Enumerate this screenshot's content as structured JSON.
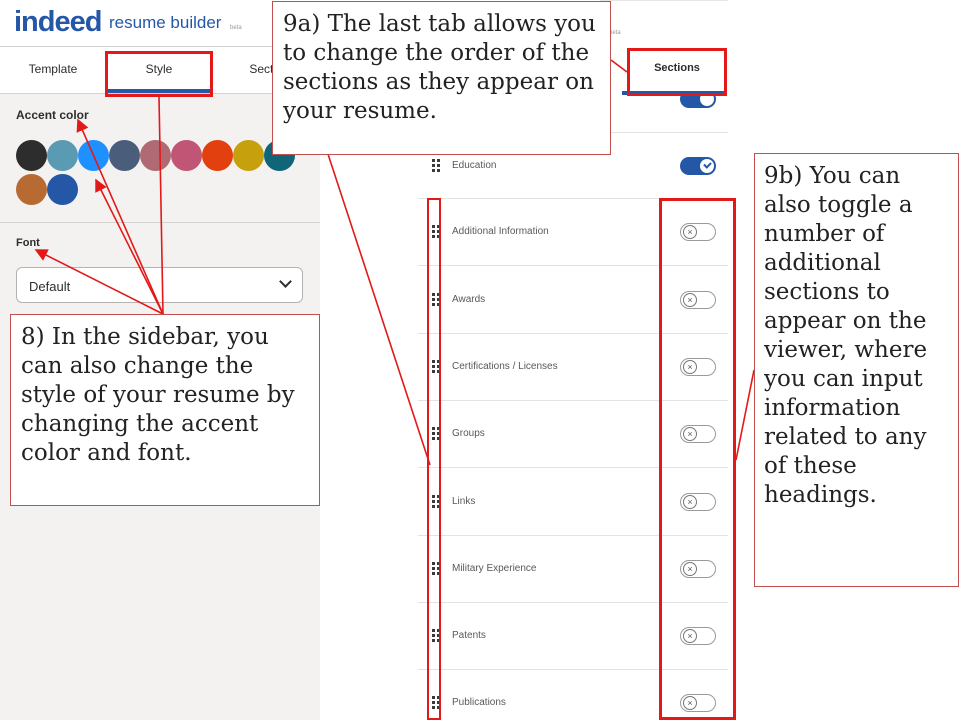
{
  "header": {
    "logo_word": "indeed",
    "logo_sub": "resume builder",
    "beta": "beta"
  },
  "sidebar": {
    "tabs": [
      {
        "label": "Template"
      },
      {
        "label": "Style"
      },
      {
        "label": "Sectio"
      }
    ],
    "accent_title": "Accent color",
    "swatches": [
      "#2d2d2d",
      "#5b9ab3",
      "#1e90ff",
      "#4a5e7c",
      "#b06a73",
      "#c05576",
      "#e2400e",
      "#c7a00e",
      "#0f6678",
      "#b86a33",
      "#2557a7"
    ],
    "font_title": "Font",
    "font_value": "Default"
  },
  "sections_panel": {
    "tab_label": "Sections",
    "beta": "beta",
    "rows": [
      {
        "label": "Education",
        "enabled": true
      },
      {
        "label": "Additional Information",
        "enabled": false
      },
      {
        "label": "Awards",
        "enabled": false
      },
      {
        "label": "Certifications / Licenses",
        "enabled": false
      },
      {
        "label": "Groups",
        "enabled": false
      },
      {
        "label": "Links",
        "enabled": false
      },
      {
        "label": "Military Experience",
        "enabled": false
      },
      {
        "label": "Patents",
        "enabled": false
      },
      {
        "label": "Publications",
        "enabled": false
      }
    ]
  },
  "annotations": {
    "note_9a": "9a) The last tab allows you to change the order of the sections as they appear on your resume.",
    "note_8": "8) In the sidebar, you can also change the style of your resume by changing the accent color and font.",
    "note_9b": "9b) You can also toggle a number of additional sections to appear on the viewer, where you can input information related to any of these headings."
  },
  "colors": {
    "brand": "#2557a7",
    "highlight": "#e31919"
  }
}
